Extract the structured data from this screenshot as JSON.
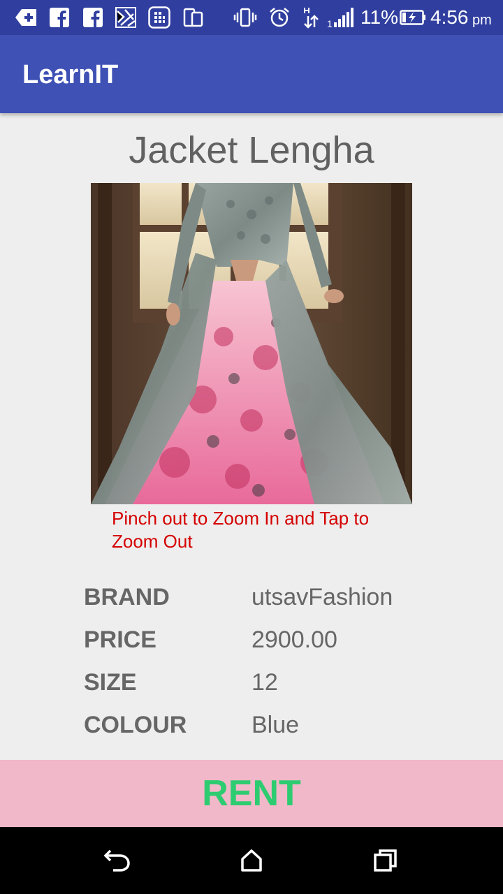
{
  "status_bar": {
    "battery_percent": "11%",
    "time": "4:56",
    "ampm": "pm",
    "icons": [
      "add-icon",
      "facebook-icon",
      "facebook-icon",
      "gallery-icon",
      "sim-icon",
      "dual-screen-icon",
      "vibrate-icon",
      "alarm-icon",
      "data-arrows-icon",
      "signal-icon",
      "battery-charging-icon"
    ]
  },
  "app_bar": {
    "title": "LearnIT"
  },
  "product": {
    "title": "Jacket Lengha",
    "image_alt": "product-photo",
    "zoom_hint": "Pinch out to Zoom In and Tap to Zoom Out",
    "specs": {
      "brand_label": "BRAND",
      "brand_value": "utsavFashion",
      "price_label": "PRICE",
      "price_value": "2900.00",
      "size_label": "SIZE",
      "size_value": "12",
      "colour_label": "COLOUR",
      "colour_value": "Blue"
    }
  },
  "action": {
    "rent_label": "RENT"
  },
  "nav_bar": {
    "icons": [
      "back-icon",
      "home-icon",
      "recents-icon"
    ]
  },
  "colors": {
    "status_bar": "#303f9f",
    "app_bar": "#3f51b5",
    "hint_text": "#d50000",
    "rent_bg": "#f0b8c8",
    "rent_text": "#2ecc71"
  }
}
